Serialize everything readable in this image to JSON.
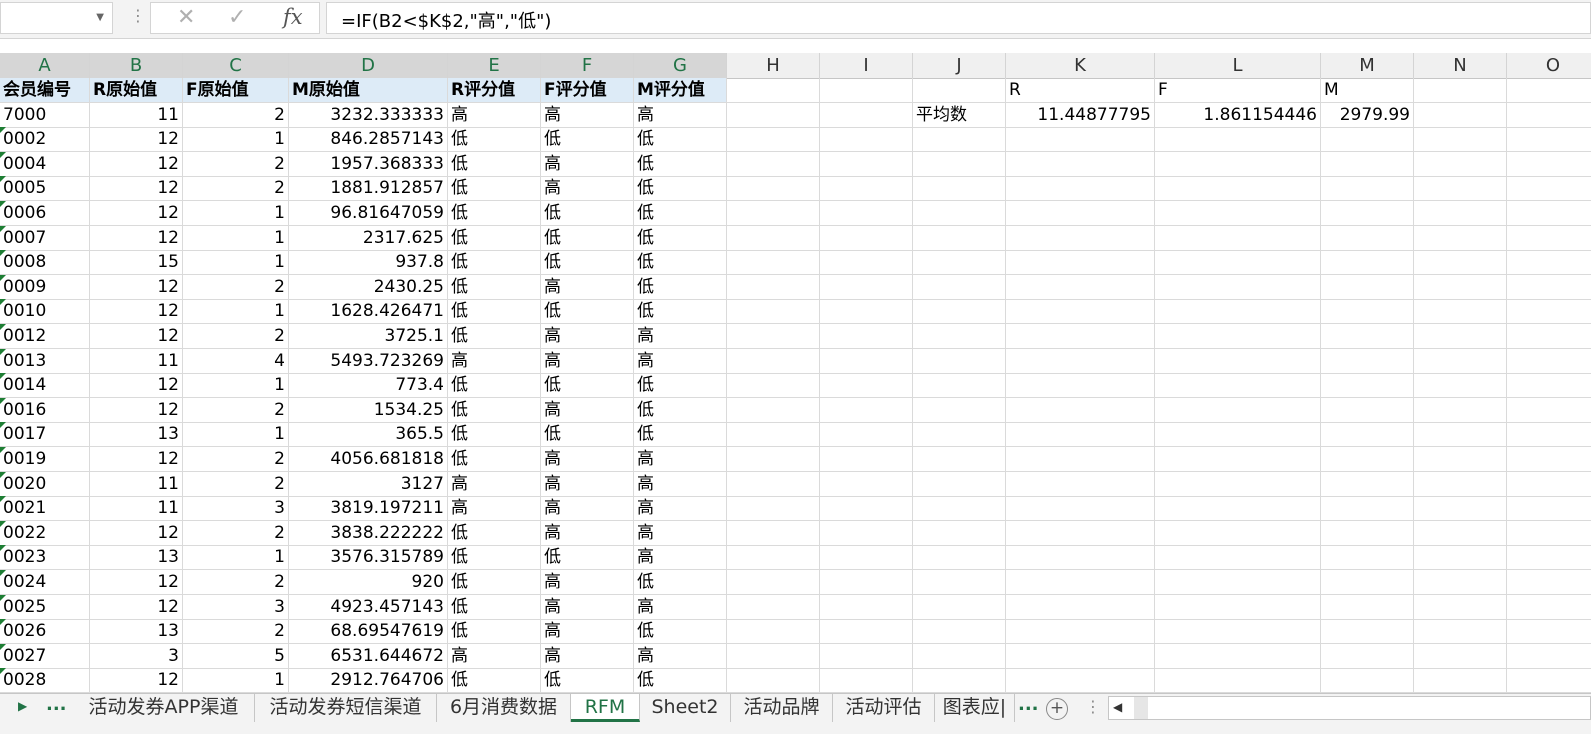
{
  "formula_bar": {
    "name_box": "",
    "cancel_icon": "✕",
    "enter_icon": "✓",
    "fx_label": "fx",
    "formula": "=IF(B2<$K$2,\"高\",\"低\")"
  },
  "columns": [
    {
      "letter": "A",
      "width": 90
    },
    {
      "letter": "B",
      "width": 93
    },
    {
      "letter": "C",
      "width": 106
    },
    {
      "letter": "D",
      "width": 159
    },
    {
      "letter": "E",
      "width": 93
    },
    {
      "letter": "F",
      "width": 93
    },
    {
      "letter": "G",
      "width": 93
    },
    {
      "letter": "H",
      "width": 93
    },
    {
      "letter": "I",
      "width": 93
    },
    {
      "letter": "J",
      "width": 93
    },
    {
      "letter": "K",
      "width": 149
    },
    {
      "letter": "L",
      "width": 166
    },
    {
      "letter": "M",
      "width": 93
    },
    {
      "letter": "N",
      "width": 93
    },
    {
      "letter": "O",
      "width": 93
    }
  ],
  "selected_columns": [
    "A",
    "B",
    "C",
    "D",
    "E",
    "F",
    "G"
  ],
  "table_header": [
    "会员编号",
    "R原始值",
    "F原始值",
    "M原始值",
    "R评分值",
    "F评分值",
    "M评分值"
  ],
  "rows": [
    [
      "7000",
      "11",
      "2",
      "3232.333333",
      "高",
      "高",
      "高"
    ],
    [
      "0002",
      "12",
      "1",
      "846.2857143",
      "低",
      "低",
      "低"
    ],
    [
      "0004",
      "12",
      "2",
      "1957.368333",
      "低",
      "高",
      "低"
    ],
    [
      "0005",
      "12",
      "2",
      "1881.912857",
      "低",
      "高",
      "低"
    ],
    [
      "0006",
      "12",
      "1",
      "96.81647059",
      "低",
      "低",
      "低"
    ],
    [
      "0007",
      "12",
      "1",
      "2317.625",
      "低",
      "低",
      "低"
    ],
    [
      "0008",
      "15",
      "1",
      "937.8",
      "低",
      "低",
      "低"
    ],
    [
      "0009",
      "12",
      "2",
      "2430.25",
      "低",
      "高",
      "低"
    ],
    [
      "0010",
      "12",
      "1",
      "1628.426471",
      "低",
      "低",
      "低"
    ],
    [
      "0012",
      "12",
      "2",
      "3725.1",
      "低",
      "高",
      "高"
    ],
    [
      "0013",
      "11",
      "4",
      "5493.723269",
      "高",
      "高",
      "高"
    ],
    [
      "0014",
      "12",
      "1",
      "773.4",
      "低",
      "低",
      "低"
    ],
    [
      "0016",
      "12",
      "2",
      "1534.25",
      "低",
      "高",
      "低"
    ],
    [
      "0017",
      "13",
      "1",
      "365.5",
      "低",
      "低",
      "低"
    ],
    [
      "0019",
      "12",
      "2",
      "4056.681818",
      "低",
      "高",
      "高"
    ],
    [
      "0020",
      "11",
      "2",
      "3127",
      "高",
      "高",
      "高"
    ],
    [
      "0021",
      "11",
      "3",
      "3819.197211",
      "高",
      "高",
      "高"
    ],
    [
      "0022",
      "12",
      "2",
      "3838.222222",
      "低",
      "高",
      "高"
    ],
    [
      "0023",
      "13",
      "1",
      "3576.315789",
      "低",
      "低",
      "高"
    ],
    [
      "0024",
      "12",
      "2",
      "920",
      "低",
      "高",
      "低"
    ],
    [
      "0025",
      "12",
      "3",
      "4923.457143",
      "低",
      "高",
      "高"
    ],
    [
      "0026",
      "13",
      "2",
      "68.69547619",
      "低",
      "高",
      "低"
    ],
    [
      "0027",
      "3",
      "5",
      "6531.644672",
      "高",
      "高",
      "高"
    ],
    [
      "0028",
      "12",
      "1",
      "2912.764706",
      "低",
      "低",
      "低"
    ]
  ],
  "summary": {
    "labels": [
      "R",
      "F",
      "M"
    ],
    "row_label": "平均数",
    "values": [
      "11.44877795",
      "1.861154446",
      "2979.99"
    ]
  },
  "tabs": [
    {
      "label": "活动发券APP渠道",
      "active": false
    },
    {
      "label": "活动发券短信渠道",
      "active": false
    },
    {
      "label": "6月消费数据",
      "active": false
    },
    {
      "label": "RFM",
      "active": true
    },
    {
      "label": "Sheet2",
      "active": false
    },
    {
      "label": "活动品牌",
      "active": false
    },
    {
      "label": "活动评估",
      "active": false
    },
    {
      "label": "图表应|",
      "active": false
    }
  ],
  "tab_nav": {
    "prev": "▶",
    "more": "...",
    "overflow": "...",
    "add": "+"
  },
  "accent_color": "#217346"
}
